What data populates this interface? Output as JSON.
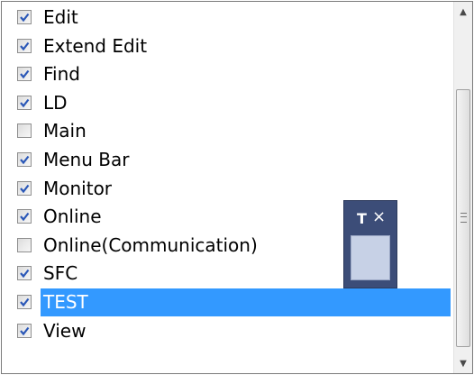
{
  "list": {
    "items": [
      {
        "label": "Edit",
        "checked": true,
        "selected": false
      },
      {
        "label": "Extend Edit",
        "checked": true,
        "selected": false
      },
      {
        "label": "Find",
        "checked": true,
        "selected": false
      },
      {
        "label": "LD",
        "checked": true,
        "selected": false
      },
      {
        "label": "Main",
        "checked": false,
        "selected": false
      },
      {
        "label": "Menu Bar",
        "checked": true,
        "selected": false
      },
      {
        "label": "Monitor",
        "checked": true,
        "selected": false
      },
      {
        "label": "Online",
        "checked": true,
        "selected": false
      },
      {
        "label": "Online(Communication)",
        "checked": false,
        "selected": false
      },
      {
        "label": "SFC",
        "checked": true,
        "selected": false
      },
      {
        "label": "TEST",
        "checked": true,
        "selected": true
      },
      {
        "label": "View",
        "checked": true,
        "selected": false
      }
    ]
  },
  "scrollbar": {
    "up_arrow": "▲",
    "down_arrow": "▼"
  },
  "floating_window": {
    "pin_glyph": "T",
    "close_glyph": "×"
  },
  "colors": {
    "selection": "#3399ff",
    "check": "#2a57b7",
    "float_window": "#3c4d78"
  }
}
